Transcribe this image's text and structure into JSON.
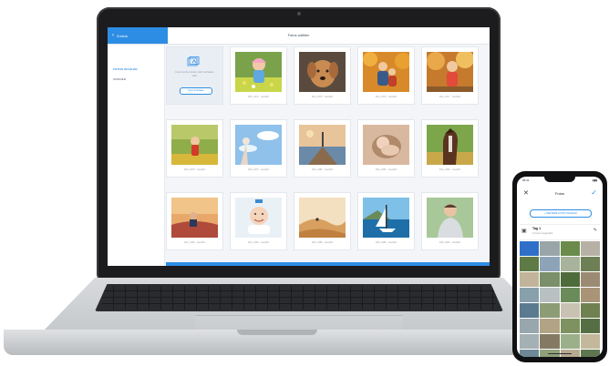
{
  "laptop": {
    "header": {
      "back_label": "Zurück",
      "title": "Fotos wählen"
    },
    "sidebar": {
      "items": [
        {
          "label": "FOTOS WÄHLEN",
          "active": true
        },
        {
          "label": "ORDNER",
          "active": false
        }
      ]
    },
    "upload": {
      "text": "Fotos hierher ziehen oder hochladen",
      "or": "oder",
      "button": "Fotos hochladen"
    },
    "tiles": [
      {
        "caption": "",
        "kind": "upload"
      },
      {
        "caption": "IMG_0274 · Gewählt",
        "kind": "girl-flowers"
      },
      {
        "caption": "IMG_0275 · Gewählt",
        "kind": "dog"
      },
      {
        "caption": "IMG_0276 · Gewählt",
        "kind": "autumn-family"
      },
      {
        "caption": "IMG_0277 · Gewählt",
        "kind": "autumn-child"
      },
      {
        "caption": "IMG_0278 · Gewählt",
        "kind": "meadow-child"
      },
      {
        "caption": "IMG_0279 · Gewählt",
        "kind": "sky-flower"
      },
      {
        "caption": "IMG_0280 · Gewählt",
        "kind": "pier"
      },
      {
        "caption": "IMG_0281 · Gewählt",
        "kind": "baby-sleep"
      },
      {
        "caption": "IMG_0282 · Gewählt",
        "kind": "horse"
      },
      {
        "caption": "IMG_0283 · Gewählt",
        "kind": "beach-couple"
      },
      {
        "caption": "IMG_0284 · Gewählt",
        "kind": "baby-smile"
      },
      {
        "caption": "IMG_0285 · Gewählt",
        "kind": "desert"
      },
      {
        "caption": "IMG_0286 · Gewählt",
        "kind": "sailboat"
      },
      {
        "caption": "IMG_0287 · Gewählt",
        "kind": "man-outdoor"
      }
    ]
  },
  "phone": {
    "status_time": "09:41",
    "status_icons": "▮▮▮",
    "title": "Fotos",
    "add_button": "+ WEITERE FOTOS WÄHLEN",
    "album": {
      "name": "Tag 1",
      "subtitle": "12 Fotos ausgewählt"
    },
    "grid_colors": [
      "#2f6fc9",
      "#9aa5a8",
      "#6a8b4a",
      "#b7b0a4",
      "#5e7a45",
      "#8da3b8",
      "#a7b39a",
      "#6d7f54",
      "#c2b49a",
      "#7a8f6a",
      "#4e6b3a",
      "#9c8b73",
      "#88a0ab",
      "#b8c0c2",
      "#6b8c5a",
      "#a99478",
      "#5b7a8f",
      "#8c9c74",
      "#c9c2b2",
      "#6f8150",
      "#98a7ad",
      "#b2a384",
      "#7d9260",
      "#566e44",
      "#a4b0b4",
      "#847a64",
      "#9bb08a",
      "#c4b89c",
      "#6e8896",
      "#8fa07a",
      "#b6aa90",
      "#5f7550"
    ]
  },
  "colors": {
    "accent": "#2d8de4"
  }
}
